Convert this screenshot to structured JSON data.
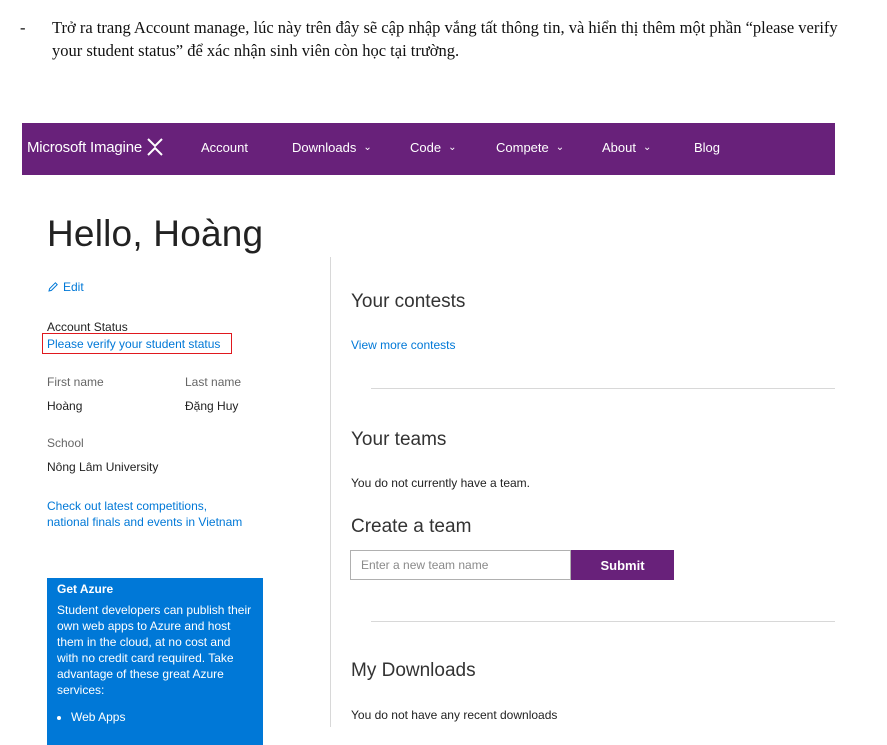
{
  "document": {
    "bullet_dash": "-",
    "paragraph": "Trở ra trang Account manage, lúc này trên đây sẽ cập nhập vắng tất thông tin, và hiển thị thêm một phần “please verify your student status” để xác nhận sinh viên còn học tại trường."
  },
  "nav": {
    "brand": "Microsoft Imagine",
    "items": [
      {
        "label": "Account",
        "chevron": ""
      },
      {
        "label": "Downloads",
        "chevron": "⌄"
      },
      {
        "label": "Code",
        "chevron": "⌄"
      },
      {
        "label": "Compete",
        "chevron": "⌄"
      },
      {
        "label": "About",
        "chevron": "⌄"
      },
      {
        "label": "Blog",
        "chevron": ""
      }
    ],
    "color": "#68217a"
  },
  "profile": {
    "greeting": "Hello, Hoàng",
    "edit_label": "Edit",
    "account_status_label": "Account Status",
    "verify_link": "Please verify your student status",
    "first_name_label": "First name",
    "last_name_label": "Last name",
    "first_name": "Hoàng",
    "last_name": "Đặng Huy",
    "school_label": "School",
    "school": "Nông Lâm University",
    "competitions_link_line1": "Check out latest competitions,",
    "competitions_link_line2": "national finals and events in Vietnam"
  },
  "azure": {
    "title": "Get Azure",
    "description": "Student developers can publish their own web apps to Azure and host them in the cloud, at no cost and with no credit card required. Take advantage of these great Azure services:",
    "items": [
      "Web Apps"
    ],
    "color": "#0078d7"
  },
  "main": {
    "contests_heading": "Your contests",
    "view_more_contests": "View more contests",
    "teams_heading": "Your teams",
    "no_team_text": "You do not currently have a team.",
    "create_team_heading": "Create a team",
    "team_name_placeholder": "Enter a new team name",
    "submit_label": "Submit",
    "downloads_heading": "My Downloads",
    "no_downloads_text": "You do not have any recent downloads"
  }
}
